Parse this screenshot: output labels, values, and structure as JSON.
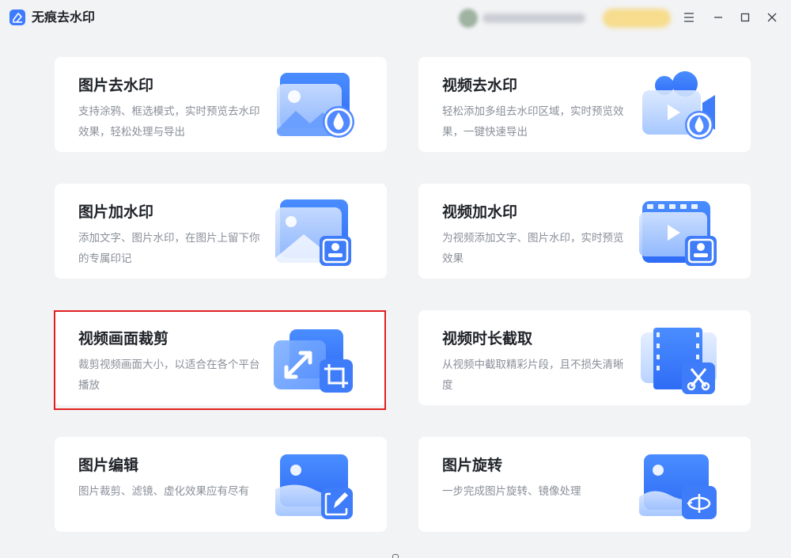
{
  "app": {
    "title": "无痕去水印",
    "logo_icon": "eraser-icon",
    "accent_color": "#3d7bff"
  },
  "window_controls": [
    "menu-icon",
    "minimize-icon",
    "maximize-icon",
    "close-icon"
  ],
  "cards": [
    {
      "title": "图片去水印",
      "desc": "支持涂鸦、框选模式，实时预览去水印效果，轻松处理与导出",
      "icon": "image-remove-watermark-icon"
    },
    {
      "title": "视频去水印",
      "desc": "轻松添加多组去水印区域，实时预览效果，一键快速导出",
      "icon": "video-remove-watermark-icon"
    },
    {
      "title": "图片加水印",
      "desc": "添加文字、图片水印，在图片上留下你的专属印记",
      "icon": "image-add-watermark-icon"
    },
    {
      "title": "视频加水印",
      "desc": "为视频添加文字、图片水印，实时预览效果",
      "icon": "video-add-watermark-icon"
    },
    {
      "title": "视频画面裁剪",
      "desc": "裁剪视频画面大小，以适合在各个平台播放",
      "icon": "video-crop-icon",
      "selected": true
    },
    {
      "title": "视频时长截取",
      "desc": "从视频中截取精彩片段，且不损失清晰度",
      "icon": "video-trim-icon"
    },
    {
      "title": "图片编辑",
      "desc": "图片裁剪、滤镜、虚化效果应有尽有",
      "icon": "image-edit-icon"
    },
    {
      "title": "图片旋转",
      "desc": "一步完成图片旋转、镜像处理",
      "icon": "image-rotate-icon"
    }
  ]
}
